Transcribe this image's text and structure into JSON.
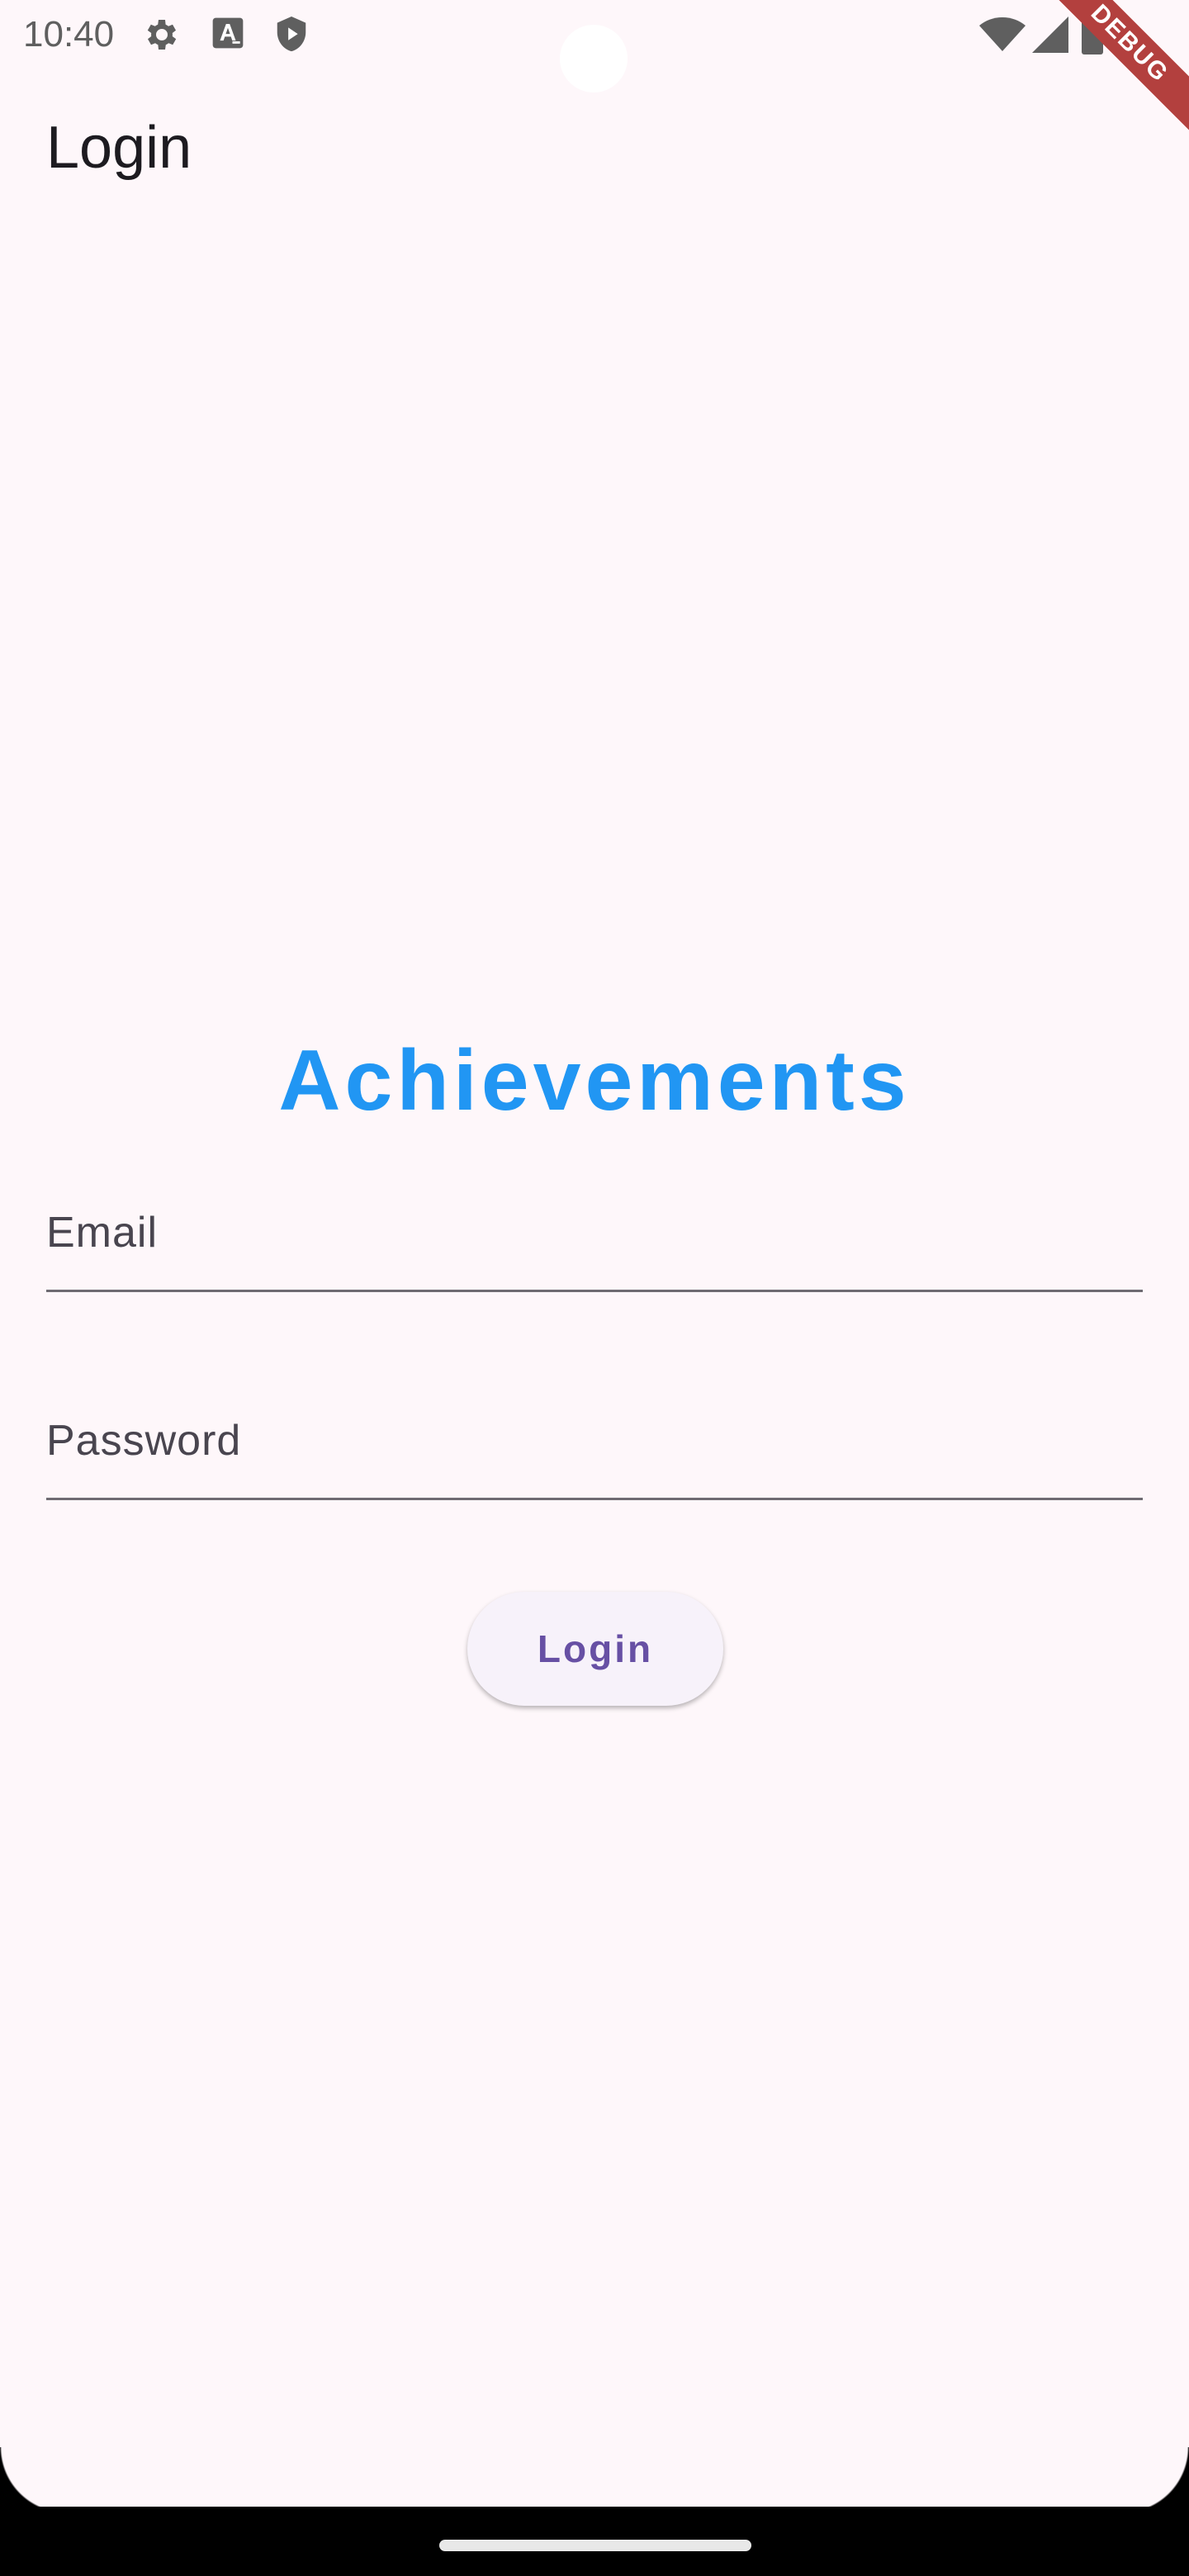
{
  "status_bar": {
    "time": "10:40",
    "left_icons": [
      "gear-icon",
      "font-a-icon",
      "shield-play-icon"
    ],
    "right_icons": [
      "wifi-icon",
      "cell-signal-icon",
      "battery-icon"
    ]
  },
  "debug_banner": {
    "label": "DEBUG"
  },
  "app_bar": {
    "title": "Login"
  },
  "main": {
    "headline": "Achievements",
    "headline_color": "#2196f3"
  },
  "form": {
    "email_label": "Email",
    "email_value": "",
    "password_label": "Password",
    "password_value": "",
    "login_button_label": "Login"
  },
  "colors": {
    "background": "#fef7fa",
    "button_text": "#6750a4",
    "button_background": "#f7f2fa",
    "debug_banner": "#b3403e"
  }
}
